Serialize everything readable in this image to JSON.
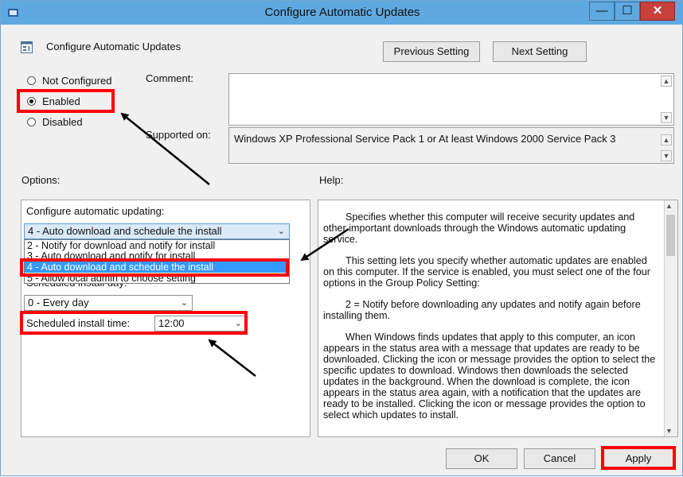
{
  "window": {
    "title": "Configure Automatic Updates",
    "minimize": "—",
    "maximize": "☐",
    "close": "✕"
  },
  "header": {
    "policy_title": "Configure Automatic Updates",
    "previous_button": "Previous Setting",
    "next_button": "Next Setting"
  },
  "state": {
    "options": [
      {
        "label": "Not Configured",
        "selected": false
      },
      {
        "label": "Enabled",
        "selected": true
      },
      {
        "label": "Disabled",
        "selected": false
      }
    ]
  },
  "comment": {
    "label": "Comment:",
    "value": ""
  },
  "supported": {
    "label": "Supported on:",
    "value": "Windows XP Professional Service Pack 1 or At least Windows 2000 Service Pack 3"
  },
  "options_label": "Options:",
  "help_label": "Help:",
  "options_panel": {
    "configure_label": "Configure automatic updating:",
    "selected_value": "4 - Auto download and schedule the install",
    "dropdown_items": [
      "2 - Notify for download and notify for install",
      "3 - Auto download and notify for install",
      "4 - Auto download and schedule the install",
      "5 - Allow local admin to choose setting"
    ],
    "hidden_label": "Scheduled install day:",
    "day_value": "0 - Every day",
    "time_label": "Scheduled install time:",
    "time_value": "12:00"
  },
  "help": {
    "paragraphs": [
      "Specifies whether this computer will receive security updates and other important downloads through the Windows automatic updating service.",
      "This setting lets you specify whether automatic updates are enabled on this computer. If the service is enabled, you must select one of the four options in the Group Policy Setting:",
      "2 = Notify before downloading any updates and notify again before installing them.",
      "When Windows finds updates that apply to this computer, an icon appears in the status area with a message that updates are ready to be downloaded. Clicking the icon or message provides the option to select the specific updates to download. Windows then downloads the selected updates in the background. When the download is complete, the icon appears in the status area again, with a notification that the updates are ready to be installed. Clicking the icon or message provides the option to select which updates to install."
    ]
  },
  "footer": {
    "ok": "OK",
    "cancel": "Cancel",
    "apply": "Apply"
  },
  "colors": {
    "titlebar": "#5fa9e0",
    "annotation": "#ff0000",
    "selection": "#3399ff"
  }
}
